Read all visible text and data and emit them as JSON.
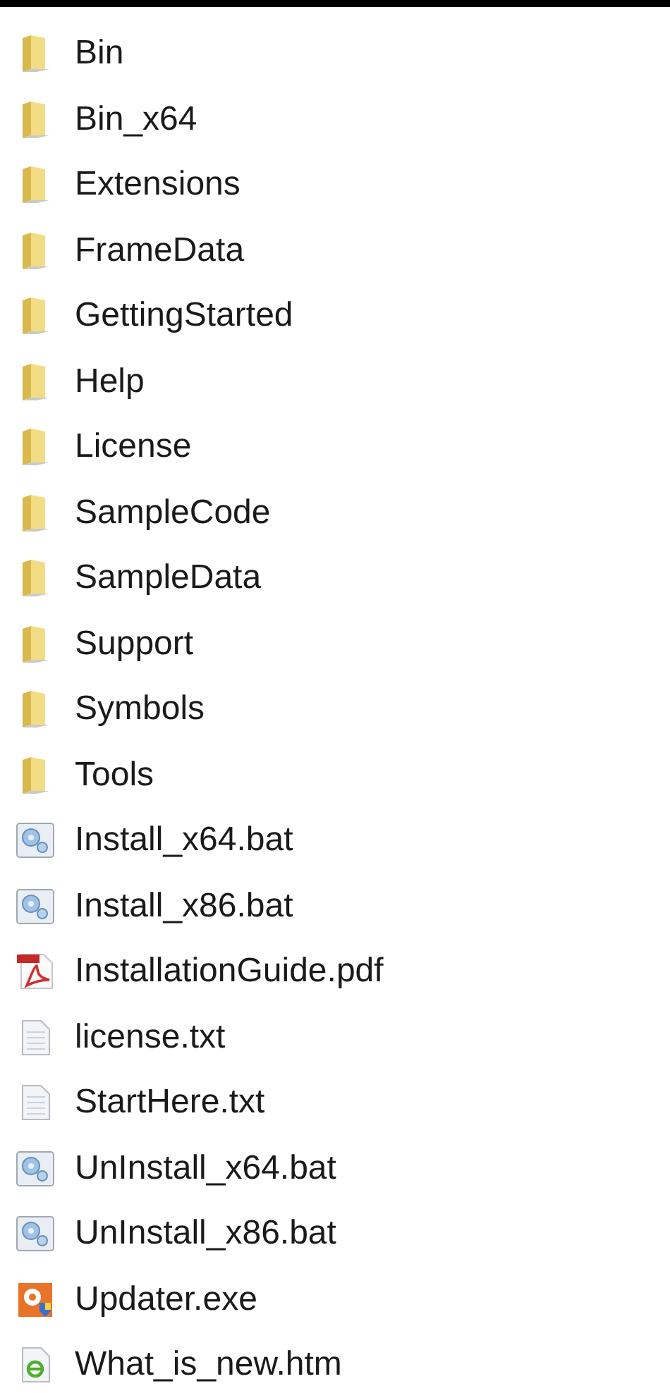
{
  "files": [
    {
      "name": "Bin",
      "kind": "folder"
    },
    {
      "name": "Bin_x64",
      "kind": "folder"
    },
    {
      "name": "Extensions",
      "kind": "folder"
    },
    {
      "name": "FrameData",
      "kind": "folder"
    },
    {
      "name": "GettingStarted",
      "kind": "folder"
    },
    {
      "name": "Help",
      "kind": "folder"
    },
    {
      "name": "License",
      "kind": "folder"
    },
    {
      "name": "SampleCode",
      "kind": "folder"
    },
    {
      "name": "SampleData",
      "kind": "folder"
    },
    {
      "name": "Support",
      "kind": "folder"
    },
    {
      "name": "Symbols",
      "kind": "folder"
    },
    {
      "name": "Tools",
      "kind": "folder"
    },
    {
      "name": "Install_x64.bat",
      "kind": "batch"
    },
    {
      "name": "Install_x86.bat",
      "kind": "batch"
    },
    {
      "name": "InstallationGuide.pdf",
      "kind": "pdf"
    },
    {
      "name": "license.txt",
      "kind": "text"
    },
    {
      "name": "StartHere.txt",
      "kind": "text"
    },
    {
      "name": "UnInstall_x64.bat",
      "kind": "batch"
    },
    {
      "name": "UnInstall_x86.bat",
      "kind": "batch"
    },
    {
      "name": "Updater.exe",
      "kind": "exe"
    },
    {
      "name": "What_is_new.htm",
      "kind": "html"
    }
  ]
}
